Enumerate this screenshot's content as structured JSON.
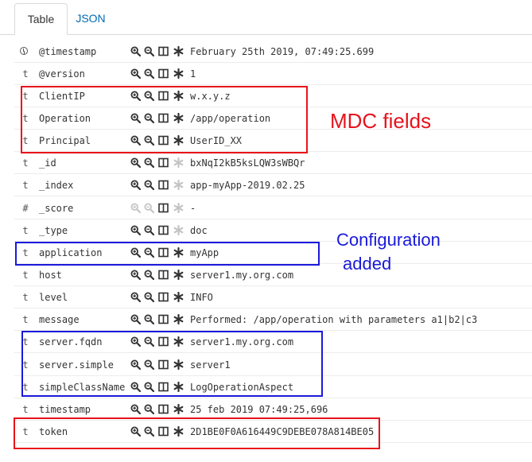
{
  "tabs": [
    {
      "label": "Table",
      "active": true
    },
    {
      "label": "JSON",
      "active": false
    }
  ],
  "rows": [
    {
      "type_icon": "clock-icon",
      "type": "",
      "name": "@timestamp",
      "value": "February 25th 2019, 07:49:25.699",
      "toggle_enabled": true,
      "filters_enabled": true
    },
    {
      "type_icon": "text",
      "type": "t",
      "name": "@version",
      "value": "1",
      "toggle_enabled": true,
      "filters_enabled": true
    },
    {
      "type_icon": "text",
      "type": "t",
      "name": "ClientIP",
      "value": "w.x.y.z",
      "toggle_enabled": true,
      "filters_enabled": true
    },
    {
      "type_icon": "text",
      "type": "t",
      "name": "Operation",
      "value": "/app/operation",
      "toggle_enabled": true,
      "filters_enabled": true
    },
    {
      "type_icon": "text",
      "type": "t",
      "name": "Principal",
      "value": "UserID_XX",
      "toggle_enabled": true,
      "filters_enabled": true
    },
    {
      "type_icon": "text",
      "type": "t",
      "name": "_id",
      "value": "bxNqI2kB5ksLQW3sWBQr",
      "toggle_enabled": false,
      "filters_enabled": true
    },
    {
      "type_icon": "text",
      "type": "t",
      "name": "_index",
      "value": "app-myApp-2019.02.25",
      "toggle_enabled": false,
      "filters_enabled": true
    },
    {
      "type_icon": "text",
      "type": "#",
      "name": "_score",
      "value": " -",
      "toggle_enabled": false,
      "filters_enabled": false
    },
    {
      "type_icon": "text",
      "type": "t",
      "name": "_type",
      "value": "doc",
      "toggle_enabled": false,
      "filters_enabled": true
    },
    {
      "type_icon": "text",
      "type": "t",
      "name": "application",
      "value": "myApp",
      "toggle_enabled": true,
      "filters_enabled": true
    },
    {
      "type_icon": "text",
      "type": "t",
      "name": "host",
      "value": "server1.my.org.com",
      "toggle_enabled": true,
      "filters_enabled": true
    },
    {
      "type_icon": "text",
      "type": "t",
      "name": "level",
      "value": "INFO",
      "toggle_enabled": true,
      "filters_enabled": true
    },
    {
      "type_icon": "text",
      "type": "t",
      "name": "message",
      "value": "Performed: /app/operation with parameters a1|b2|c3",
      "toggle_enabled": true,
      "filters_enabled": true
    },
    {
      "type_icon": "text",
      "type": "t",
      "name": "server.fqdn",
      "value": "server1.my.org.com",
      "toggle_enabled": true,
      "filters_enabled": true
    },
    {
      "type_icon": "text",
      "type": "t",
      "name": "server.simple",
      "value": "server1",
      "toggle_enabled": true,
      "filters_enabled": true
    },
    {
      "type_icon": "text",
      "type": "t",
      "name": "simpleClassName",
      "value": "LogOperationAspect",
      "toggle_enabled": true,
      "filters_enabled": true
    },
    {
      "type_icon": "text",
      "type": "t",
      "name": "timestamp",
      "value": "25 feb 2019 07:49:25,696",
      "toggle_enabled": true,
      "filters_enabled": true
    },
    {
      "type_icon": "text",
      "type": "t",
      "name": "token",
      "value": "2D1BE0F0A616449C9DEBE078A814BE05",
      "toggle_enabled": true,
      "filters_enabled": true
    }
  ],
  "row_actions": [
    "zoom-in-icon",
    "zoom-out-icon",
    "columns-icon",
    "asterisk-icon"
  ],
  "annotations": {
    "mdc": {
      "text": "MDC fields",
      "color": "#e8121b"
    },
    "config_line1": "Configuration",
    "config_line2": "added",
    "config_color": "#1a1adb"
  },
  "colors": {
    "red_box": "#e8121b",
    "blue_box": "#1a1adb",
    "link": "#006bb4",
    "icon_active": "#333333",
    "icon_disabled": "#c4c4c4"
  }
}
